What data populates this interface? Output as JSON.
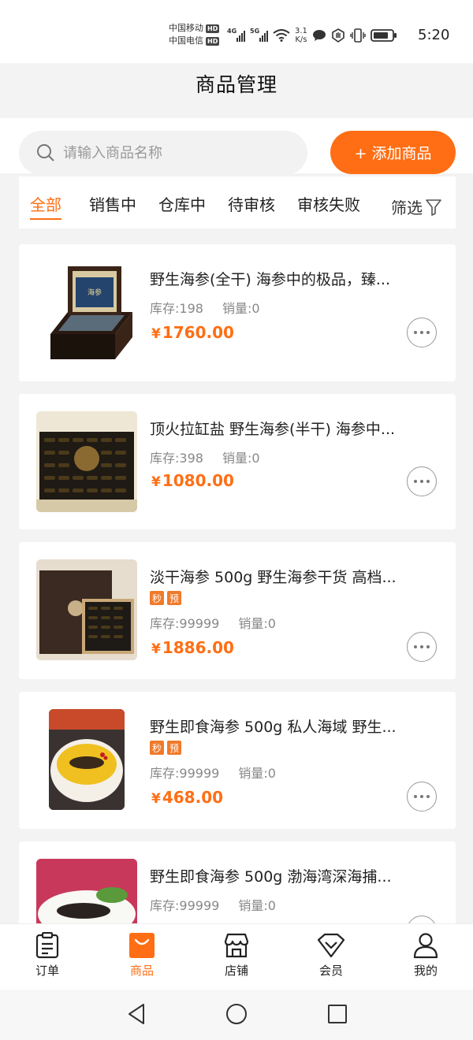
{
  "status_bar": {
    "carrier1": "中国移动",
    "carrier2": "中国电信",
    "hd": "HD",
    "net1": "4G",
    "net2": "5G",
    "speed_value": "3.1",
    "speed_unit": "K/s",
    "time": "5:20"
  },
  "header": {
    "title": "商品管理"
  },
  "search": {
    "placeholder": "请输入商品名称",
    "value": ""
  },
  "add_button": {
    "label": "+ 添加商品"
  },
  "tabs": [
    {
      "label": "全部",
      "active": true
    },
    {
      "label": "销售中"
    },
    {
      "label": "仓库中"
    },
    {
      "label": "待审核"
    },
    {
      "label": "审核失败"
    }
  ],
  "filter": {
    "label": "筛选"
  },
  "labels": {
    "stock": "库存:",
    "sales": "销量:",
    "currency": "¥"
  },
  "products": [
    {
      "title": "野生海参(全干) 海参中的极品，臻...",
      "stock": "198",
      "sales": "0",
      "price": "1760.00",
      "badges": []
    },
    {
      "title": "顶火拉缸盐 野生海参(半干) 海参中...",
      "stock": "398",
      "sales": "0",
      "price": "1080.00",
      "badges": []
    },
    {
      "title": "淡干海参 500g 野生海参干货 高档...",
      "stock": "99999",
      "sales": "0",
      "price": "1886.00",
      "badges": [
        "秒",
        "预"
      ]
    },
    {
      "title": "野生即食海参 500g 私人海域 野生...",
      "stock": "99999",
      "sales": "0",
      "price": "468.00",
      "badges": [
        "秒",
        "预"
      ]
    },
    {
      "title": "野生即食海参 500g 渤海湾深海捕...",
      "stock": "99999",
      "sales": "0",
      "price": "",
      "badges": []
    }
  ],
  "bottom_nav": [
    {
      "label": "订单",
      "icon": "clipboard-icon"
    },
    {
      "label": "商品",
      "icon": "shopping-bag-icon",
      "active": true
    },
    {
      "label": "店铺",
      "icon": "store-icon"
    },
    {
      "label": "会员",
      "icon": "diamond-icon"
    },
    {
      "label": "我的",
      "icon": "user-icon"
    }
  ],
  "colors": {
    "accent": "#ff6e14",
    "badge": "#f07a2a"
  }
}
